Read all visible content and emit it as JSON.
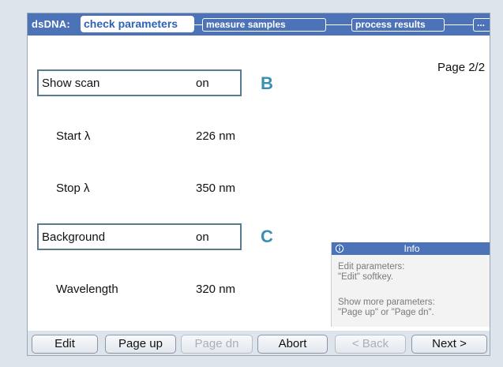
{
  "header": {
    "app_label": "dsDNA:",
    "active_tab": "check parameters",
    "tabs": [
      "measure samples",
      "process results"
    ],
    "more_tab": "...",
    "accent_color": "#4c73b8"
  },
  "page_indicator": "Page 2/2",
  "parameters": [
    {
      "label": "Show scan",
      "value": "on",
      "boxed": true,
      "marker": "B"
    },
    {
      "label": "Start λ",
      "value": "226  nm",
      "boxed": false
    },
    {
      "label": "Stop λ",
      "value": "350  nm",
      "boxed": false
    },
    {
      "label": "Background",
      "value": "on",
      "boxed": true,
      "marker": "C"
    },
    {
      "label": "Wavelength",
      "value": "320  nm",
      "boxed": false
    }
  ],
  "info_panel": {
    "title": "Info",
    "icon": "info-icon",
    "line1": "Edit parameters:",
    "line2": "\"Edit\" softkey.",
    "line3": "Show more parameters:",
    "line4": "\"Page up\" or \"Page dn\"."
  },
  "softkeys": [
    {
      "label": "Edit",
      "enabled": true
    },
    {
      "label": "Page up",
      "enabled": true
    },
    {
      "label": "Page dn",
      "enabled": false
    },
    {
      "label": "Abort",
      "enabled": true
    },
    {
      "label": "< Back",
      "enabled": false
    },
    {
      "label": "Next >",
      "enabled": true
    }
  ]
}
